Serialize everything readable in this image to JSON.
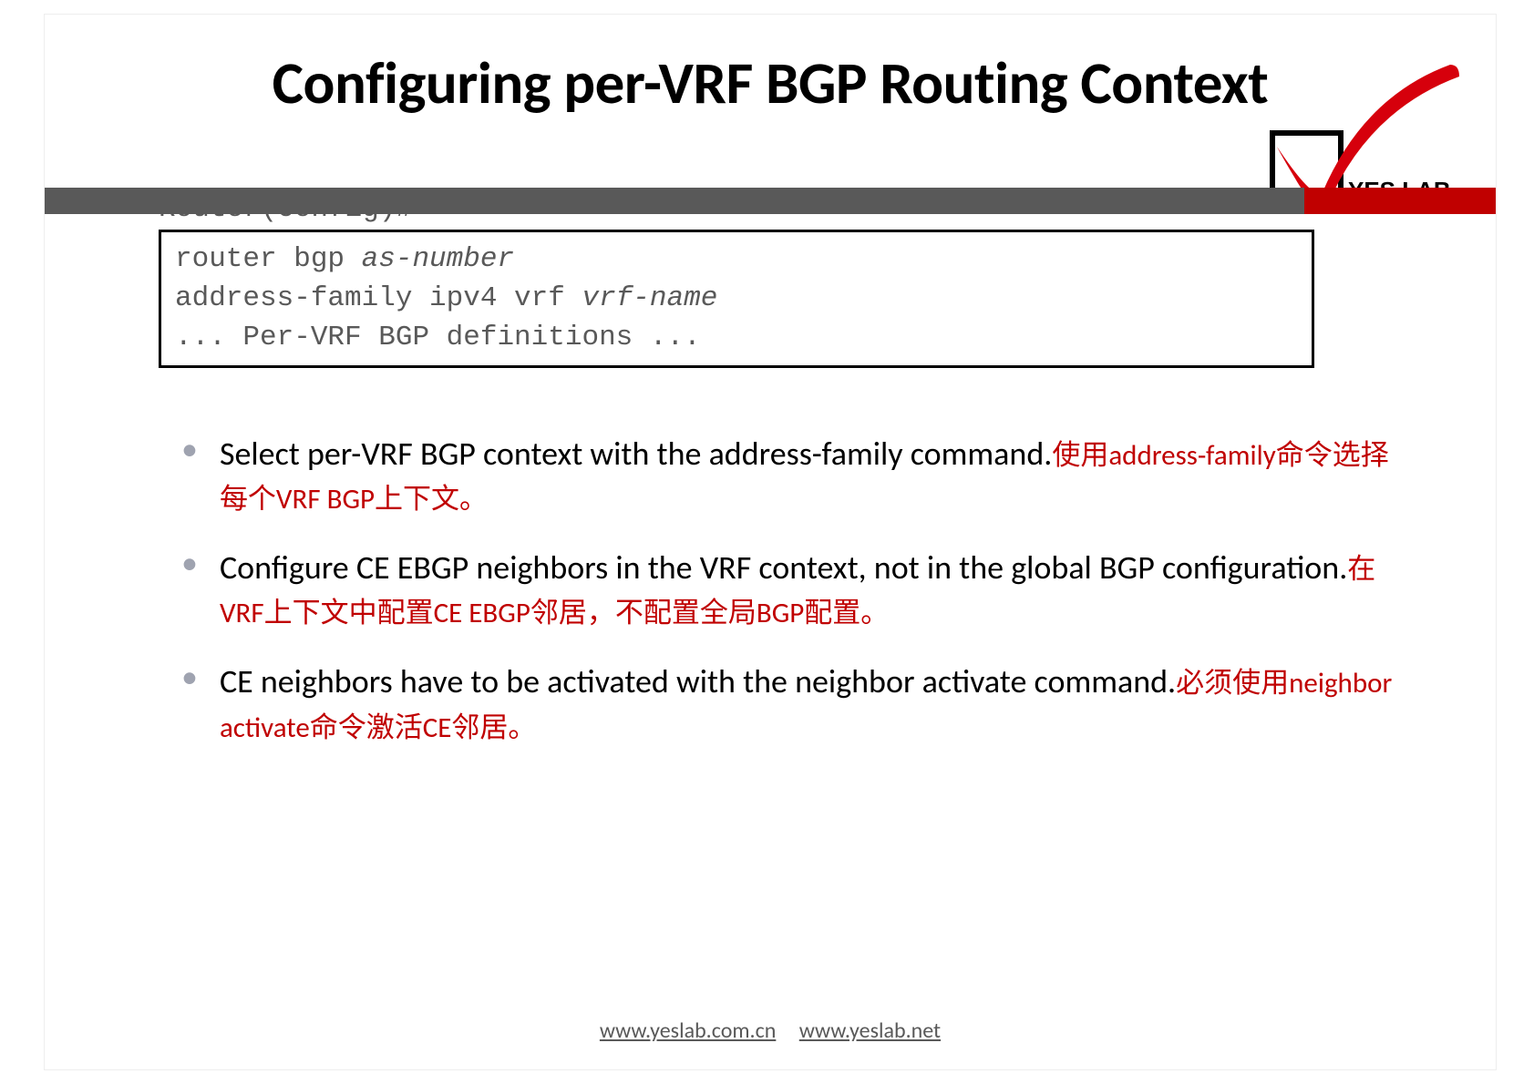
{
  "title": "Configuring per-VRF BGP Routing Context",
  "logo_text": "YES LAB",
  "prompt": "Router(config)#",
  "code": {
    "line1a": "router bgp ",
    "line1b": "as-number",
    "line2a": "  address-family  ipv4 vrf ",
    "line2b": "vrf-name",
    "line3": "    ... Per-VRF BGP definitions ..."
  },
  "bullets": [
    {
      "en_a": "Select per-VRF BGP context with the ",
      "en_b": "address-family ",
      "en_c": "command.",
      "cn": "使用address-family命令选择每个VRF BGP上下文。"
    },
    {
      "en_a": "Configure CE EBGP neighbors in the VRF context, not in the global BGP configuration.",
      "en_b": "",
      "en_c": "",
      "cn": "在VRF上下文中配置CE EBGP邻居，不配置全局BGP配置。"
    },
    {
      "en_a": "CE neighbors have to be activated with the ",
      "en_b": "neighbor activate ",
      "en_c": "command.",
      "cn": "必须使用neighbor activate命令激活CE邻居。"
    }
  ],
  "footer": {
    "url1": "www.yeslab.com.cn",
    "url2": "www.yeslab.net"
  }
}
